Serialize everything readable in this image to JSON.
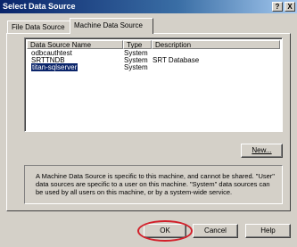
{
  "window": {
    "title": "Select Data Source",
    "help_glyph": "?",
    "close_glyph": "X"
  },
  "tabs": [
    {
      "label": "File Data Source"
    },
    {
      "label": "Machine Data Source"
    }
  ],
  "list": {
    "columns": [
      "Data Source Name",
      "Type",
      "Description"
    ],
    "rows": [
      {
        "name": "odbcauthtest",
        "type": "System",
        "description": ""
      },
      {
        "name": "SRTTNDB",
        "type": "System",
        "description": "SRT Database"
      },
      {
        "name": "titan-sqlserver",
        "type": "System",
        "description": ""
      }
    ],
    "selected_row": "titan-sqlserver"
  },
  "buttons": {
    "new": "New...",
    "ok": "OK",
    "cancel": "Cancel",
    "help": "Help"
  },
  "info_text": "A Machine Data Source is specific to this machine, and cannot be shared. \"User\" data sources are specific to a user on this machine.  \"System\" data sources can be used by all users on this machine, or by a system-wide service.",
  "colors": {
    "title_bar": "#0a246a",
    "selection": "#0a246a",
    "annotation_circle": "#d2202a"
  }
}
